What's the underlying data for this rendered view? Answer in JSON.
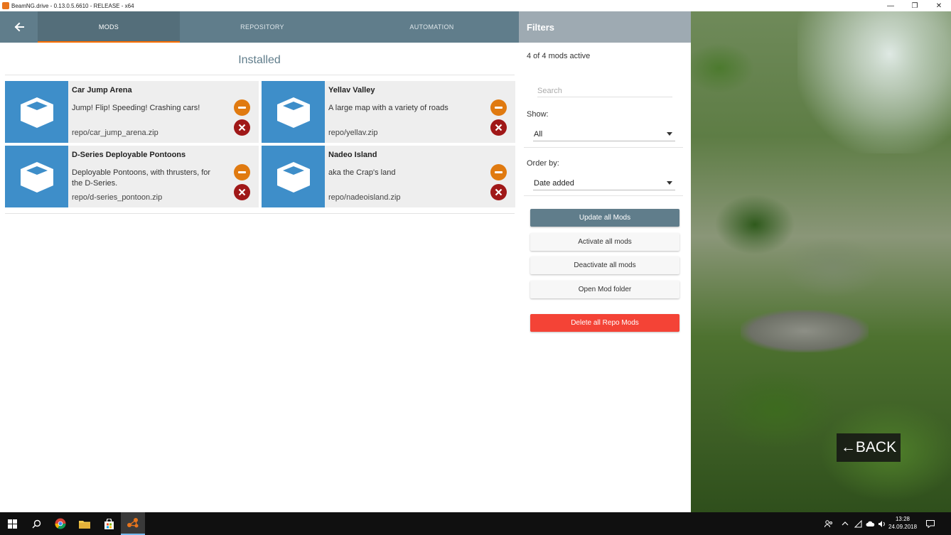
{
  "window": {
    "title": "BeamNG.drive - 0.13.0.5.6610 - RELEASE - x64",
    "minimize": "—",
    "maximize": "❐",
    "close": "✕"
  },
  "nav": {
    "tabs": [
      {
        "label": "MODS",
        "active": true
      },
      {
        "label": "REPOSITORY",
        "active": false
      },
      {
        "label": "AUTOMATION",
        "active": false
      }
    ]
  },
  "main": {
    "section_title": "Installed",
    "mods": [
      {
        "name": "Car Jump Arena",
        "description": "Jump! Flip! Speeding! Crashing cars!",
        "path": "repo/car_jump_arena.zip"
      },
      {
        "name": "Yellav Valley",
        "description": "A large map with a variety of roads",
        "path": "repo/yellav.zip"
      },
      {
        "name": "D-Series Deployable Pontoons",
        "description": "Deployable Pontoons, with thrusters, for the D-Series.",
        "path": "repo/d-series_pontoon.zip"
      },
      {
        "name": "Nadeo Island",
        "description": "aka the Crap's land",
        "path": "repo/nadeoisland.zip"
      }
    ]
  },
  "filters": {
    "title": "Filters",
    "count_text": "4 of 4 mods active",
    "search_placeholder": "Search",
    "show_label": "Show:",
    "show_value": "All",
    "order_label": "Order by:",
    "order_value": "Date added",
    "buttons": {
      "update_all": "Update all Mods",
      "activate_all": "Activate all mods",
      "deactivate_all": "Deactivate all mods",
      "open_folder": "Open Mod folder",
      "delete_all": "Delete all Repo Mods"
    }
  },
  "scene": {
    "back_label": "←BACK"
  },
  "taskbar": {
    "time": "13:28",
    "date": "24.09.2018"
  },
  "colors": {
    "nav": "#607d8b",
    "accent": "#ff6d00",
    "thumb": "#3e8ec9",
    "deactivate": "#e07a10",
    "delete": "#a01818",
    "danger": "#f44336"
  }
}
